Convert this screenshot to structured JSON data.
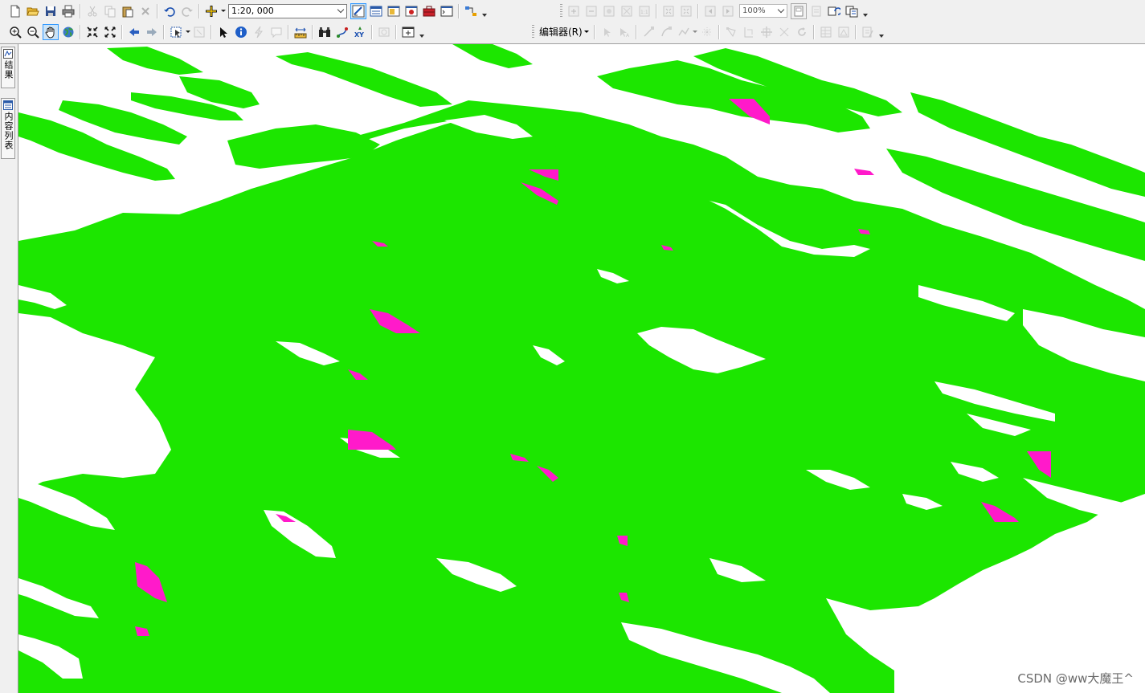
{
  "toolbar": {
    "scale_value": "1:20, 000",
    "zoom_percent": "100%",
    "editor_label": "编辑器(R)"
  },
  "dock": {
    "results_label": "结果",
    "toc_label": "内容列表"
  },
  "map": {
    "colors": {
      "background": "#ffffff",
      "fill": "#1ce600",
      "highlight": "#ff1aca"
    }
  },
  "watermark": "CSDN @ww大魔王^"
}
